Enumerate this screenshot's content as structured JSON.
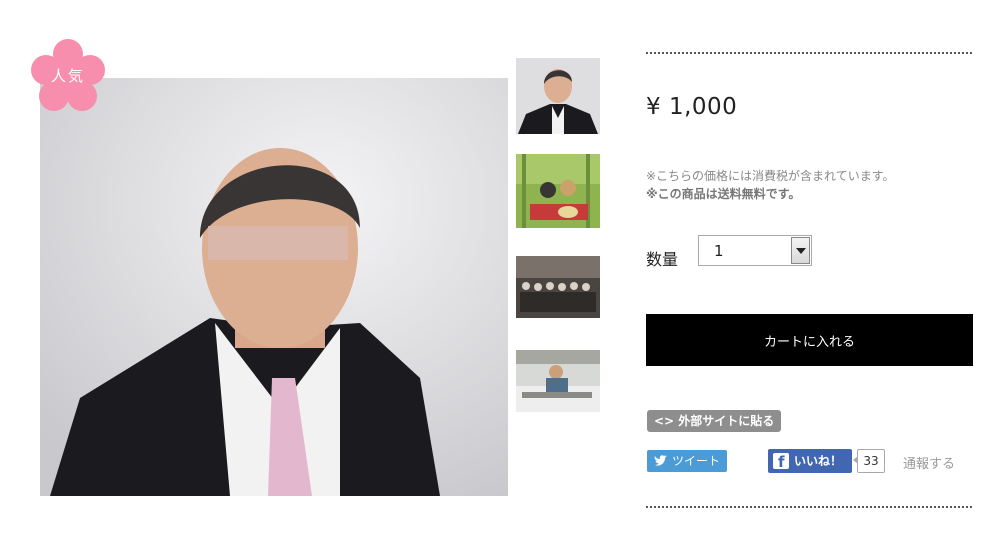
{
  "product": {
    "badge_label": "人気",
    "price": "¥ 1,000",
    "tax_note": "※こちらの価格には消費税が含まれています。",
    "shipping_note": "※この商品は送料無料です。",
    "quantity_label": "数量",
    "quantity_value": "1",
    "cart_button": "カートに入れる",
    "embed_button": "<> 外部サイトに貼る"
  },
  "social": {
    "tweet_label": "ツイート",
    "like_label": "いいね！",
    "like_count": "33",
    "report_label": "通報する"
  },
  "colors": {
    "badge": "#f78eae",
    "cart_button": "#000000",
    "twitter": "#4a9bd6",
    "facebook": "#4267b2"
  }
}
